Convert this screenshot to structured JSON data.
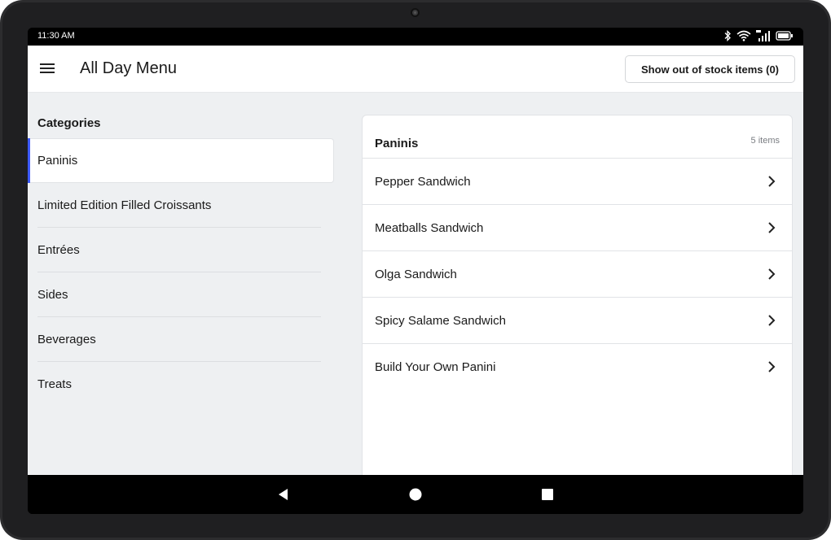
{
  "status_bar": {
    "time": "11:30 AM",
    "icons": [
      "bluetooth-icon",
      "wifi-icon",
      "cell-signal-icon",
      "battery-icon"
    ]
  },
  "app_bar": {
    "menu_icon": "hamburger-menu-icon",
    "title": "All Day Menu",
    "out_of_stock_button": "Show out of stock items (0)"
  },
  "sidebar": {
    "heading": "Categories",
    "items": [
      {
        "label": "Paninis",
        "selected": true
      },
      {
        "label": "Limited Edition Filled Croissants",
        "selected": false
      },
      {
        "label": "Entrées",
        "selected": false
      },
      {
        "label": "Sides",
        "selected": false
      },
      {
        "label": "Beverages",
        "selected": false
      },
      {
        "label": "Treats",
        "selected": false
      }
    ]
  },
  "items_panel": {
    "title": "Paninis",
    "count": "5 items",
    "items": [
      {
        "label": "Pepper Sandwich",
        "icon": "chevron-right-icon"
      },
      {
        "label": "Meatballs Sandwich",
        "icon": "chevron-right-icon"
      },
      {
        "label": "Olga Sandwich",
        "icon": "chevron-right-icon"
      },
      {
        "label": "Spicy Salame Sandwich",
        "icon": "chevron-right-icon"
      },
      {
        "label": "Build Your Own Panini",
        "icon": "chevron-right-icon"
      }
    ]
  },
  "nav_bar": {
    "icons": [
      "back-icon",
      "home-icon",
      "recents-icon"
    ]
  },
  "colors": {
    "accent": "#3d5afe",
    "background": "#eef0f2",
    "surface": "#ffffff",
    "bezel": "#1f1f21"
  }
}
